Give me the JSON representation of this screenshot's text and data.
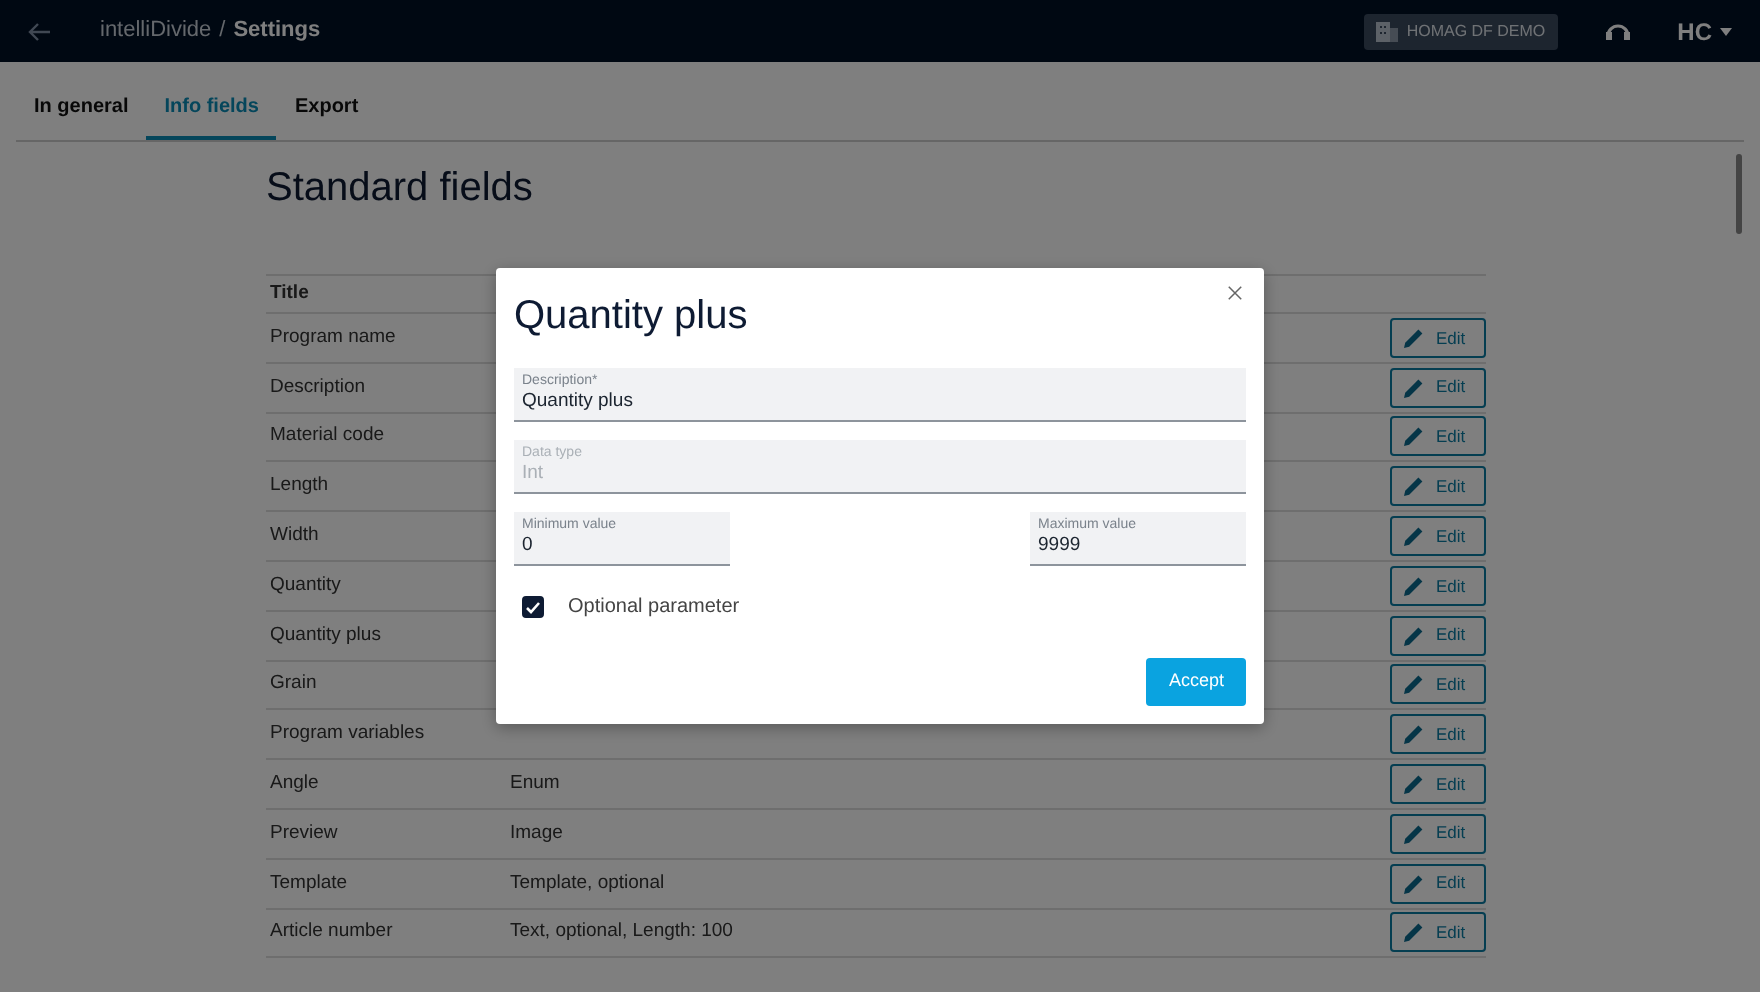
{
  "navbar": {
    "app_name": "intelliDivide",
    "separator": "/",
    "page": "Settings",
    "tenant": "HOMAG DF DEMO",
    "user_initials": "HC"
  },
  "tabs": [
    {
      "label": "In general",
      "selected": false
    },
    {
      "label": "Info fields",
      "selected": true
    },
    {
      "label": "Export",
      "selected": false
    }
  ],
  "section_title": "Standard fields",
  "table": {
    "columns": [
      "Title"
    ],
    "rows": [
      {
        "title": "Program name",
        "edit": "Edit"
      },
      {
        "title": "Description",
        "edit": "Edit"
      },
      {
        "title": "Material code",
        "edit": "Edit"
      },
      {
        "title": "Length",
        "edit": "Edit"
      },
      {
        "title": "Width",
        "edit": "Edit"
      },
      {
        "title": "Quantity",
        "edit": "Edit"
      },
      {
        "title": "Quantity plus",
        "edit": "Edit"
      },
      {
        "title": "Grain",
        "edit": "Edit"
      },
      {
        "title": "Program variables",
        "edit": "Edit"
      },
      {
        "title": "Angle",
        "type": "Enum",
        "edit": "Edit"
      },
      {
        "title": "Preview",
        "type": "Image",
        "edit": "Edit"
      },
      {
        "title": "Template",
        "type": "Template, optional",
        "edit": "Edit"
      },
      {
        "title": "Article number",
        "type": "Text, optional, Length: 100",
        "edit": "Edit"
      }
    ]
  },
  "dialog": {
    "title": "Quantity plus",
    "fields": [
      {
        "label": "Description*",
        "value": "Quantity plus",
        "disabled": false
      },
      {
        "label": "Data type",
        "value": "Int",
        "disabled": true
      }
    ],
    "range_fields": [
      {
        "label": "Minimum value",
        "value": "0"
      },
      {
        "label": "Maximum value",
        "value": "9999"
      }
    ],
    "checkbox": {
      "label": "Optional parameter",
      "checked": true
    },
    "button": "Accept"
  }
}
